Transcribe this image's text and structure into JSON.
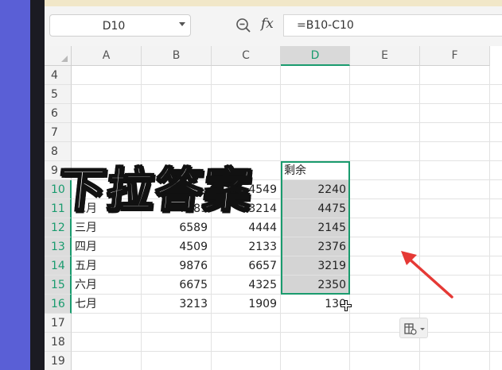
{
  "name_box": {
    "value": "D10"
  },
  "formula_bar": {
    "fx_label": "fx",
    "value": "=B10-C10"
  },
  "columns": [
    "A",
    "B",
    "C",
    "D",
    "E",
    "F"
  ],
  "rows": [
    "4",
    "5",
    "6",
    "7",
    "8",
    "9",
    "10",
    "11",
    "12",
    "13",
    "14",
    "15",
    "16",
    "17",
    "18",
    "19"
  ],
  "table": {
    "header_d": "剩余",
    "data": [
      {
        "a": "",
        "b": "",
        "c": "4549",
        "d": "2240"
      },
      {
        "a": "二月",
        "b": "7689",
        "c": "3214",
        "d": "4475"
      },
      {
        "a": "三月",
        "b": "6589",
        "c": "4444",
        "d": "2145"
      },
      {
        "a": "四月",
        "b": "4509",
        "c": "2133",
        "d": "2376"
      },
      {
        "a": "五月",
        "b": "9876",
        "c": "6657",
        "d": "3219"
      },
      {
        "a": "六月",
        "b": "6675",
        "c": "4325",
        "d": "2350"
      },
      {
        "a": "七月",
        "b": "3213",
        "c": "1909",
        "d": "130"
      }
    ]
  },
  "overlay_caption": "下拉答案",
  "colors": {
    "accent": "#1a9b6e",
    "arrow": "#e53935",
    "bezel_bg": "#5a5fd6"
  }
}
